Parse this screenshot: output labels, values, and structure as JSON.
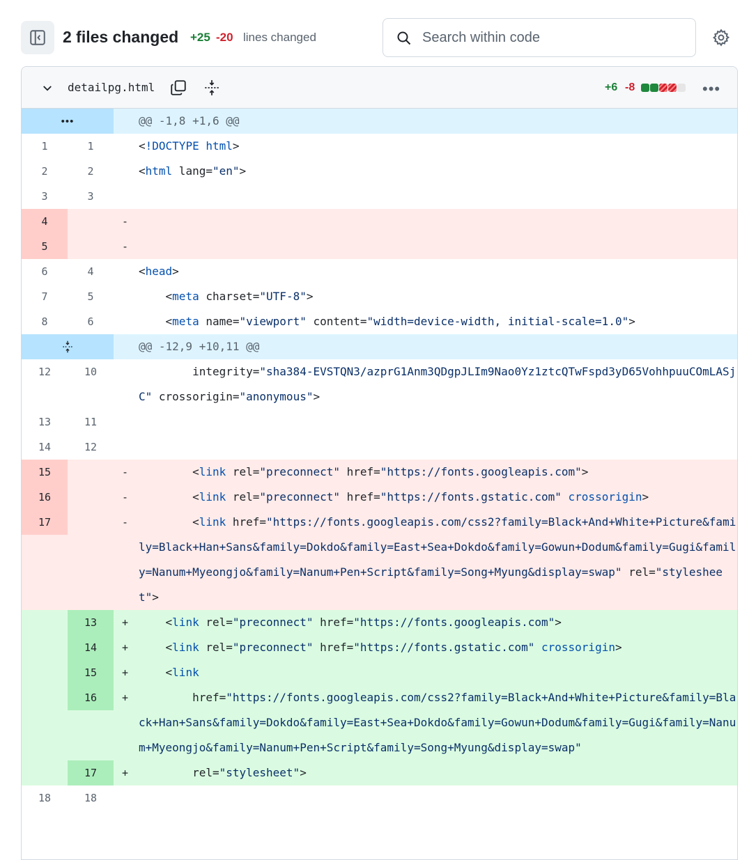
{
  "toolbar": {
    "files_changed": "2 files changed",
    "additions": "+25",
    "deletions": "-20",
    "lines_changed_label": "lines changed",
    "search_placeholder": "Search within code"
  },
  "file": {
    "name": "detailpg.html",
    "additions": "+6",
    "deletions": "-8",
    "diffstat": [
      "add",
      "add",
      "del",
      "del",
      "neutral"
    ]
  },
  "hunks": [
    {
      "header": "@@ -1,8 +1,6 @@"
    },
    {
      "header": "@@ -12,9 +10,11 @@"
    }
  ],
  "lines": [
    {
      "type": "hunk",
      "hunk_index": 0
    },
    {
      "type": "ctx",
      "old": "1",
      "new": "1",
      "text": "<!DOCTYPE html>"
    },
    {
      "type": "ctx",
      "old": "2",
      "new": "2",
      "text": "<html lang=\"en\">"
    },
    {
      "type": "ctx",
      "old": "3",
      "new": "3",
      "text": ""
    },
    {
      "type": "del",
      "old": "4",
      "new": "",
      "text": ""
    },
    {
      "type": "del",
      "old": "5",
      "new": "",
      "text": ""
    },
    {
      "type": "ctx",
      "old": "6",
      "new": "4",
      "text": "<head>"
    },
    {
      "type": "ctx",
      "old": "7",
      "new": "5",
      "text": "    <meta charset=\"UTF-8\">"
    },
    {
      "type": "ctx",
      "old": "8",
      "new": "6",
      "text": "    <meta name=\"viewport\" content=\"width=device-width, initial-scale=1.0\">"
    },
    {
      "type": "hunk",
      "hunk_index": 1
    },
    {
      "type": "ctx",
      "old": "12",
      "new": "10",
      "text": "        integrity=\"sha384-EVSTQN3/azprG1Anm3QDgpJLIm9Nao0Yz1ztcQTwFspd3yD65VohhpuuCOmLASjC\" crossorigin=\"anonymous\">"
    },
    {
      "type": "ctx",
      "old": "13",
      "new": "11",
      "text": ""
    },
    {
      "type": "ctx",
      "old": "14",
      "new": "12",
      "text": ""
    },
    {
      "type": "del",
      "old": "15",
      "new": "",
      "text": "        <link rel=\"preconnect\" href=\"https://fonts.googleapis.com\">"
    },
    {
      "type": "del",
      "old": "16",
      "new": "",
      "text": "        <link rel=\"preconnect\" href=\"https://fonts.gstatic.com\" crossorigin>"
    },
    {
      "type": "del",
      "old": "17",
      "new": "",
      "text": "        <link href=\"https://fonts.googleapis.com/css2?family=Black+And+White+Picture&family=Black+Han+Sans&family=Dokdo&family=East+Sea+Dokdo&family=Gowun+Dodum&family=Gugi&family=Nanum+Myeongjo&family=Nanum+Pen+Script&family=Song+Myung&display=swap\" rel=\"stylesheet\">"
    },
    {
      "type": "add",
      "old": "",
      "new": "13",
      "text": "    <link rel=\"preconnect\" href=\"https://fonts.googleapis.com\">"
    },
    {
      "type": "add",
      "old": "",
      "new": "14",
      "text": "    <link rel=\"preconnect\" href=\"https://fonts.gstatic.com\" crossorigin>"
    },
    {
      "type": "add",
      "old": "",
      "new": "15",
      "text": "    <link"
    },
    {
      "type": "add",
      "old": "",
      "new": "16",
      "text": "        href=\"https://fonts.googleapis.com/css2?family=Black+And+White+Picture&family=Black+Han+Sans&family=Dokdo&family=East+Sea+Dokdo&family=Gowun+Dodum&family=Gugi&family=Nanum+Myeongjo&family=Nanum+Pen+Script&family=Song+Myung&display=swap\""
    },
    {
      "type": "add",
      "old": "",
      "new": "17",
      "text": "        rel=\"stylesheet\">"
    },
    {
      "type": "ctx",
      "old": "18",
      "new": "18",
      "text": ""
    }
  ]
}
